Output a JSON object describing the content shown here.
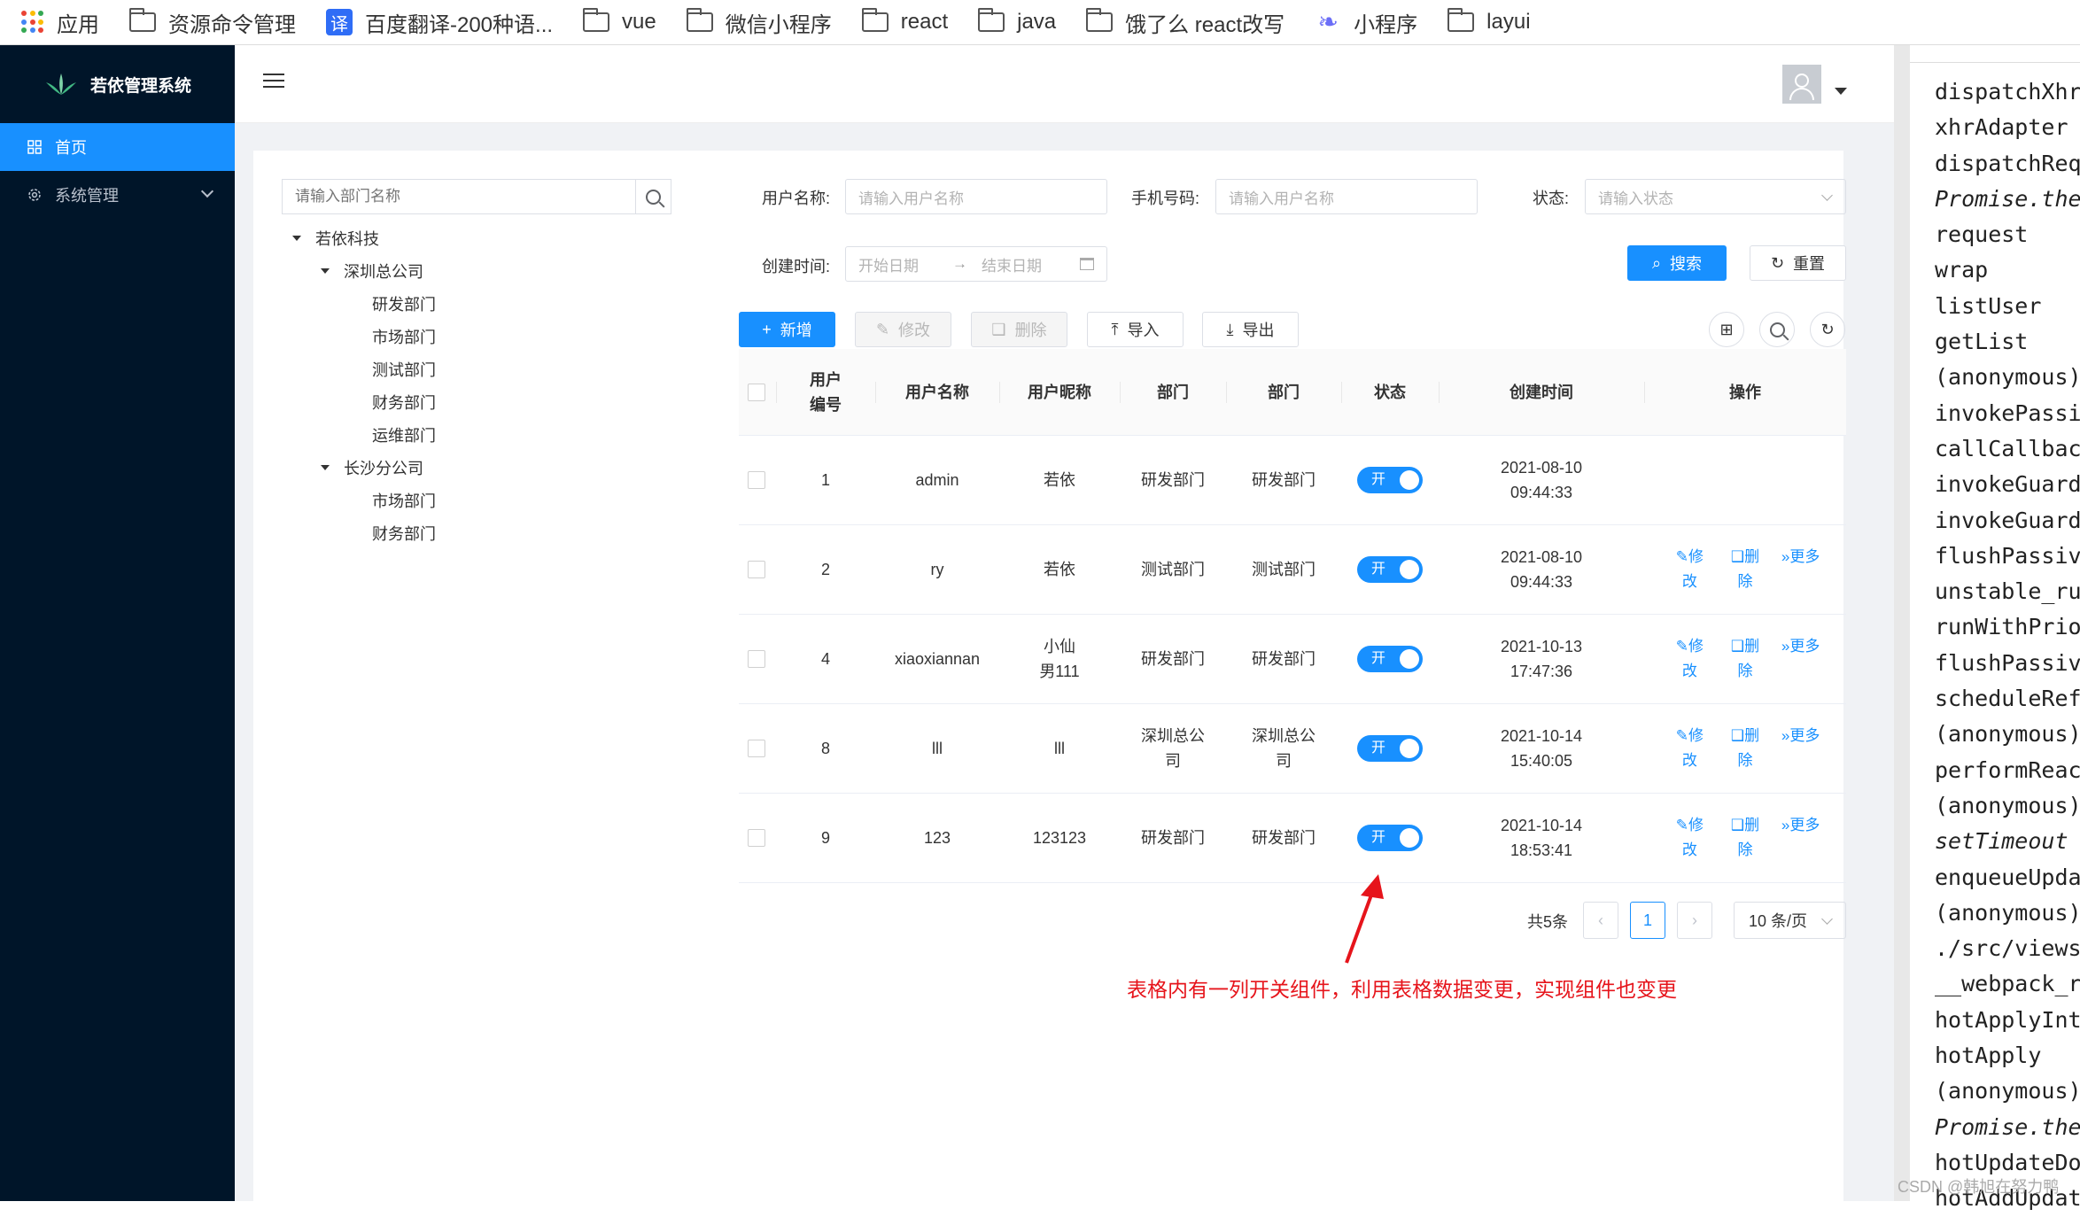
{
  "bookmarks": [
    {
      "label": "应用",
      "icon": "apps-grid-icon"
    },
    {
      "label": "资源命令管理",
      "icon": "folder-icon"
    },
    {
      "label": "百度翻译-200种语...",
      "icon": "translate-icon"
    },
    {
      "label": "vue",
      "icon": "folder-icon"
    },
    {
      "label": "微信小程序",
      "icon": "folder-icon"
    },
    {
      "label": "react",
      "icon": "folder-icon"
    },
    {
      "label": "java",
      "icon": "folder-icon"
    },
    {
      "label": "饿了么 react改写",
      "icon": "folder-icon"
    },
    {
      "label": "小程序",
      "icon": "mini-program-icon"
    },
    {
      "label": "layui",
      "icon": "folder-icon"
    }
  ],
  "sidebar": {
    "title": "若依管理系统",
    "items": [
      {
        "label": "首页",
        "icon": "dashboard-icon"
      },
      {
        "label": "系统管理",
        "icon": "gear-icon"
      }
    ]
  },
  "tree": {
    "search_placeholder": "请输入部门名称",
    "nodes": [
      {
        "label": "若依科技"
      },
      {
        "label": "深圳总公司"
      },
      {
        "label": "研发部门"
      },
      {
        "label": "市场部门"
      },
      {
        "label": "测试部门"
      },
      {
        "label": "财务部门"
      },
      {
        "label": "运维部门"
      },
      {
        "label": "长沙分公司"
      },
      {
        "label": "市场部门"
      },
      {
        "label": "财务部门"
      }
    ]
  },
  "filters": {
    "username_label": "用户名称:",
    "username_placeholder": "请输入用户名称",
    "phone_label": "手机号码:",
    "phone_placeholder": "请输入用户名称",
    "status_label": "状态:",
    "status_placeholder": "请输入状态",
    "created_label": "创建时间:",
    "start_placeholder": "开始日期",
    "range_sep": "→",
    "end_placeholder": "结束日期",
    "search_btn": "搜索",
    "reset_btn": "重置"
  },
  "toolbar": {
    "add": "新增",
    "edit": "修改",
    "delete": "删除",
    "import": "导入",
    "export": "导出"
  },
  "table": {
    "columns": [
      "用户编号",
      "用户名称",
      "用户昵称",
      "部门",
      "部门",
      "状态",
      "创建时间",
      "操作"
    ],
    "rows": [
      {
        "id": "1",
        "username": "admin",
        "nickname": "若依",
        "dept1": "研发部门",
        "dept2": "研发部门",
        "status": "开",
        "date": "2021-08-10",
        "time": "09:44:33",
        "ops": false
      },
      {
        "id": "2",
        "username": "ry",
        "nickname": "若依",
        "dept1": "测试部门",
        "dept2": "测试部门",
        "status": "开",
        "date": "2021-08-10",
        "time": "09:44:33",
        "ops": true
      },
      {
        "id": "4",
        "username": "xiaoxiannan",
        "nickname": "小仙男111",
        "dept1": "研发部门",
        "dept2": "研发部门",
        "status": "开",
        "date": "2021-10-13",
        "time": "17:47:36",
        "ops": true
      },
      {
        "id": "8",
        "username": "lll",
        "nickname": "lll",
        "dept1": "深圳总公司",
        "dept2": "深圳总公司",
        "status": "开",
        "date": "2021-10-14",
        "time": "15:40:05",
        "ops": true
      },
      {
        "id": "9",
        "username": "123",
        "nickname": "123123",
        "dept1": "研发部门",
        "dept2": "研发部门",
        "status": "开",
        "date": "2021-10-14",
        "time": "18:53:41",
        "ops": true
      }
    ],
    "op_edit": "修改",
    "op_delete": "删除",
    "op_more": "更多"
  },
  "pagination": {
    "total": "共5条",
    "current": "1",
    "page_size": "10 条/页"
  },
  "annotation": "表格内有一列开关组件，利用表格数据变更，实现组件也变更",
  "devtools_stack": [
    {
      "text": "dispatchXhrRequest",
      "italic": false
    },
    {
      "text": "xhrAdapter",
      "italic": false
    },
    {
      "text": "dispatchRequest",
      "italic": false
    },
    {
      "text": "Promise.then",
      "italic": true
    },
    {
      "text": "request",
      "italic": false
    },
    {
      "text": "wrap",
      "italic": false
    },
    {
      "text": "listUser",
      "italic": false
    },
    {
      "text": "getList",
      "italic": false
    },
    {
      "text": "(anonymous)",
      "italic": false
    },
    {
      "text": "invokePassiveEffectCreate",
      "italic": false
    },
    {
      "text": "callCallback",
      "italic": false
    },
    {
      "text": "invokeGuardedCallbackDev",
      "italic": false
    },
    {
      "text": "invokeGuardedCallback",
      "italic": false
    },
    {
      "text": "flushPassiveEffectsImpl",
      "italic": false
    },
    {
      "text": "unstable_runWithPriority",
      "italic": false
    },
    {
      "text": "runWithPriority",
      "italic": false
    },
    {
      "text": "flushPassiveEffects",
      "italic": false
    },
    {
      "text": "scheduleRefresh",
      "italic": false
    },
    {
      "text": "(anonymous)",
      "italic": false
    },
    {
      "text": "performReactRefresh",
      "italic": false
    },
    {
      "text": "(anonymous)",
      "italic": false
    },
    {
      "text": "setTimeout (async)",
      "italic": true
    },
    {
      "text": "enqueueUpdate",
      "italic": false
    },
    {
      "text": "(anonymous)",
      "italic": false
    },
    {
      "text": "./src/views/",
      "italic": false
    },
    {
      "text": "__webpack_require__",
      "italic": false
    },
    {
      "text": "hotApplyInternal",
      "italic": false
    },
    {
      "text": "hotApply",
      "italic": false
    },
    {
      "text": "(anonymous)",
      "italic": false
    },
    {
      "text": "Promise.then",
      "italic": true
    },
    {
      "text": "hotUpdateDownloaded",
      "italic": false
    },
    {
      "text": "hotAddUpdateChunk",
      "italic": false
    }
  ],
  "watermark": "CSDN @韩旭在努力鸭",
  "colors": {
    "sidebar_bg": "#001529",
    "primary": "#1890ff",
    "annotation": "#e6141b"
  }
}
